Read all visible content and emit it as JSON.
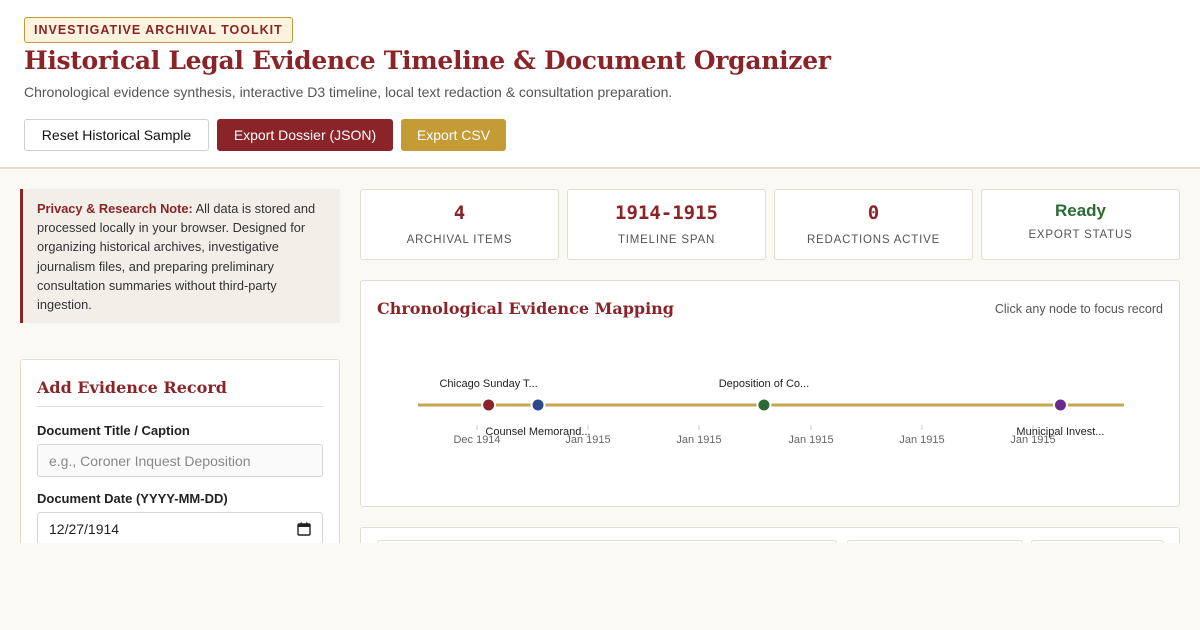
{
  "header": {
    "badge": "INVESTIGATIVE ARCHIVAL TOOLKIT",
    "title": "Historical Legal Evidence Timeline & Document Organizer",
    "subtitle": "Chronological evidence synthesis, interactive D3 timeline, local text redaction & consultation preparation.",
    "buttons": {
      "reset": "Reset Historical Sample",
      "export_json": "Export Dossier (JSON)",
      "export_csv": "Export CSV"
    }
  },
  "note": {
    "heading": "Privacy & Research Note:",
    "text": "All data is stored and processed locally in your browser. Designed for organizing historical archives, investigative journalism files, and preparing preliminary consultation summaries without third-party ingestion."
  },
  "form": {
    "title": "Add Evidence Record",
    "title_label": "Document Title / Caption",
    "title_placeholder": "e.g., Coroner Inquest Deposition",
    "date_label": "Document Date (YYYY-MM-DD)",
    "date_value": "12/27/1914"
  },
  "stats": [
    {
      "value": "4",
      "label": "ARCHIVAL ITEMS"
    },
    {
      "value": "1914-1915",
      "label": "TIMELINE SPAN"
    },
    {
      "value": "0",
      "label": "REDACTIONS ACTIVE"
    },
    {
      "value": "Ready",
      "label": "EXPORT STATUS"
    }
  ],
  "timeline": {
    "title": "Chronological Evidence Mapping",
    "hint": "Click any node to focus record",
    "tick_labels": [
      "Dec 1914",
      "Jan 1915",
      "Jan 1915",
      "Jan 1915",
      "Jan 1915",
      "Jan 1915"
    ],
    "events": [
      {
        "label": "Chicago Sunday T...",
        "color": "#8b2428",
        "label_position": "above",
        "position": 0.1
      },
      {
        "label": "Counsel Memorand...",
        "color": "#2a4a8c",
        "label_position": "below",
        "position": 0.17
      },
      {
        "label": "Deposition of Co...",
        "color": "#2c6b35",
        "label_position": "above",
        "position": 0.49
      },
      {
        "label": "Municipal Invest...",
        "color": "#6a2c8c",
        "label_position": "below",
        "position": 0.91
      }
    ],
    "colors": {
      "axis": "#c5a54e",
      "tick": "#cccccc",
      "tick_label": "#666666",
      "event_label": "#222222"
    }
  }
}
